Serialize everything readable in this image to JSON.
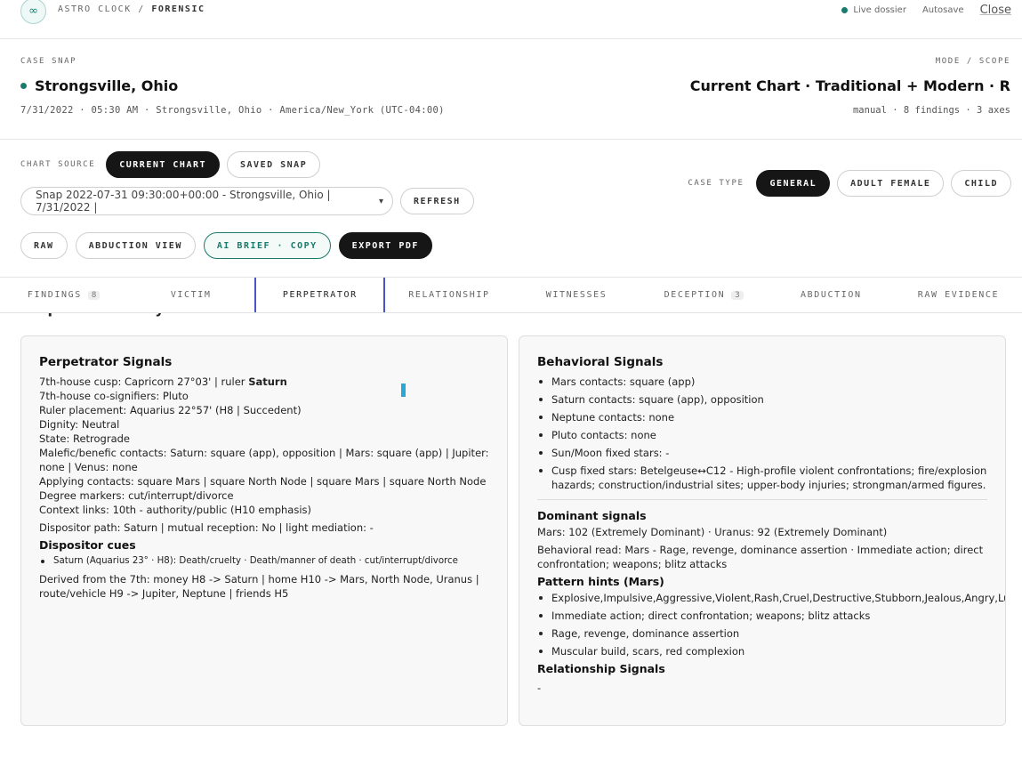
{
  "header": {
    "logo_glyph": "∞",
    "brand": "ASTRO CLOCK",
    "separator": "/",
    "section": "FORENSIC",
    "live_label": "Live dossier",
    "autosave_label": "Autosave",
    "close_label": "Close"
  },
  "case": {
    "label": "CASE SNAP",
    "title": "Strongsville, Ohio",
    "meta": "7/31/2022 · 05:30 AM · Strongsville, Ohio · America/New_York (UTC-04:00)"
  },
  "scope": {
    "label": "MODE / SCOPE",
    "title": "Current Chart · Traditional + Modern · R",
    "meta": "manual · 8 findings · 3 axes"
  },
  "chart_source": {
    "label": "CHART SOURCE",
    "current_label": "CURRENT CHART",
    "saved_label": "SAVED SNAP",
    "snap_value": "Snap 2022-07-31 09:30:00+00:00 - Strongsville, Ohio | 7/31/2022 |",
    "refresh_label": "REFRESH"
  },
  "actions": {
    "raw": "RAW",
    "abduction_view": "ABDUCTION VIEW",
    "ai_brief": "AI BRIEF · COPY",
    "export_pdf": "EXPORT PDF"
  },
  "case_type": {
    "label": "CASE TYPE",
    "general": "GENERAL",
    "adult_female": "ADULT FEMALE",
    "child": "CHILD"
  },
  "tabs": [
    {
      "label": "FINDINGS",
      "badge": "8"
    },
    {
      "label": "VICTIM",
      "badge": ""
    },
    {
      "label": "PERPETRATOR",
      "badge": ""
    },
    {
      "label": "RELATIONSHIP",
      "badge": ""
    },
    {
      "label": "WITNESSES",
      "badge": ""
    },
    {
      "label": "DECEPTION",
      "badge": "3"
    },
    {
      "label": "ABDUCTION",
      "badge": ""
    },
    {
      "label": "RAW EVIDENCE",
      "badge": ""
    }
  ],
  "active_tab": "PERPETRATOR",
  "section_heading": "Perpetrator Analysis",
  "perpetrator": {
    "title": "Perpetrator Signals",
    "cusp_prefix": "7th-house cusp: Capricorn 27°03' | ruler ",
    "cusp_ruler": "Saturn",
    "lines": [
      "7th-house co-signifiers: Pluto",
      "Ruler placement: Aquarius 22°57' (H8 | Succedent)",
      "Dignity: Neutral",
      "State: Retrograde",
      "Malefic/benefic contacts: Saturn: square (app), opposition | Mars: square (app) | Jupiter: none | Venus: none",
      "Applying contacts: square Mars | square North Node | square Mars | square North Node",
      "Degree markers: cut/interrupt/divorce",
      "Context links: 10th - authority/public (H10 emphasis)"
    ],
    "dispositor_path": "Dispositor path: Saturn | mutual reception: No | light mediation: -",
    "dispositor_cues_title": "Dispositor cues",
    "dispositor_cues": [
      "Saturn (Aquarius 23° · H8): Death/cruelty · Death/manner of death · cut/interrupt/divorce"
    ],
    "derived": "Derived from the 7th: money H8 -> Saturn | home H10 -> Mars, North Node, Uranus | route/vehicle H9 -> Jupiter, Neptune | friends H5"
  },
  "behavioral": {
    "title": "Behavioral Signals",
    "items": [
      "Mars contacts: square (app)",
      "Saturn contacts: square (app), opposition",
      "Neptune contacts: none",
      "Pluto contacts: none",
      "Sun/Moon fixed stars: -",
      "Cusp fixed stars: Betelgeuse↔C12 - High-profile violent confrontations; fire/explosion hazards; construction/industrial sites; upper-body injuries; strongman/armed figures."
    ]
  },
  "dominant": {
    "title": "Dominant signals",
    "scores": "Mars: 102 (Extremely Dominant) · Uranus: 92 (Extremely Dominant)",
    "read": "Behavioral read: Mars - Rage, revenge, dominance assertion · Immediate action; direct confrontation; weapons; blitz attacks"
  },
  "pattern": {
    "title": "Pattern hints (Mars)",
    "items": [
      "Explosive,Impulsive,Aggressive,Violent,Rash,Cruel,Destructive,Stubborn,Jealous,Angry,Lustful,Unfeeling",
      "Immediate action; direct confrontation; weapons; blitz attacks",
      "Rage, revenge, dominance assertion",
      "Muscular build, scars, red complexion"
    ]
  },
  "relationship": {
    "title": "Relationship Signals",
    "value": "-"
  }
}
